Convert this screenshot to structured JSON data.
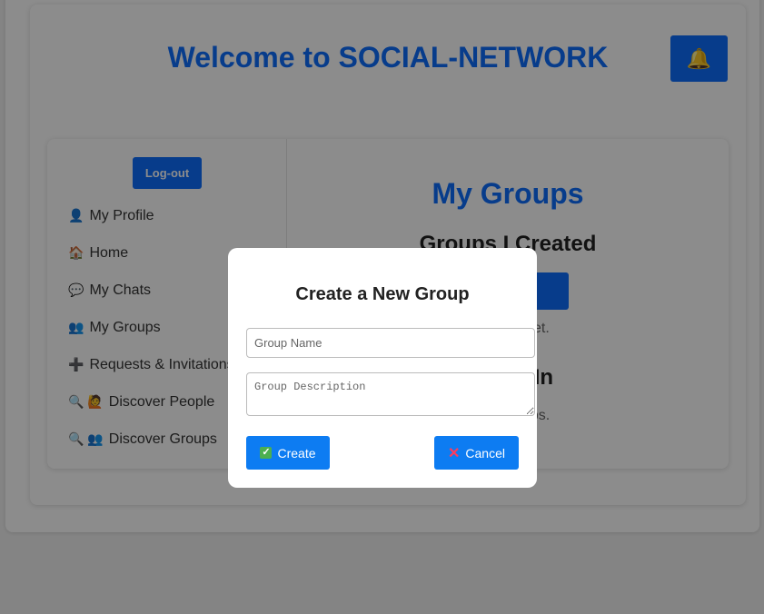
{
  "header": {
    "title": "Welcome to SOCIAL-NETWORK",
    "bell_icon": "🔔"
  },
  "sidebar": {
    "logout_label": "Log-out",
    "items": [
      {
        "icon": "👤",
        "label": "My Profile"
      },
      {
        "icon": "🏠",
        "label": "Home"
      },
      {
        "icon": "💬",
        "label": "My Chats"
      },
      {
        "icon": "👥",
        "label": "My Groups"
      },
      {
        "icon": "➕",
        "label": "Requests & Invitations"
      },
      {
        "icon": "🔍 🙋",
        "label": "Discover People"
      },
      {
        "icon": "🔍 👥",
        "label": "Discover Groups"
      }
    ]
  },
  "main": {
    "title": "My Groups",
    "groups_created_heading": "Groups I Created",
    "new_group_button": "up",
    "no_groups_text": "y groups yet.",
    "member_heading": "ember In",
    "not_member_text": "f any groups."
  },
  "modal": {
    "title": "Create a New Group",
    "name_placeholder": "Group Name",
    "name_value": "",
    "description_placeholder": "Group Description",
    "description_value": "",
    "create_label": "Create",
    "create_icon": "✓",
    "cancel_label": "Cancel",
    "cancel_icon": "✕"
  },
  "colors": {
    "accent": "#0d6efd",
    "overlay": "rgba(0,0,0,0.45)"
  }
}
